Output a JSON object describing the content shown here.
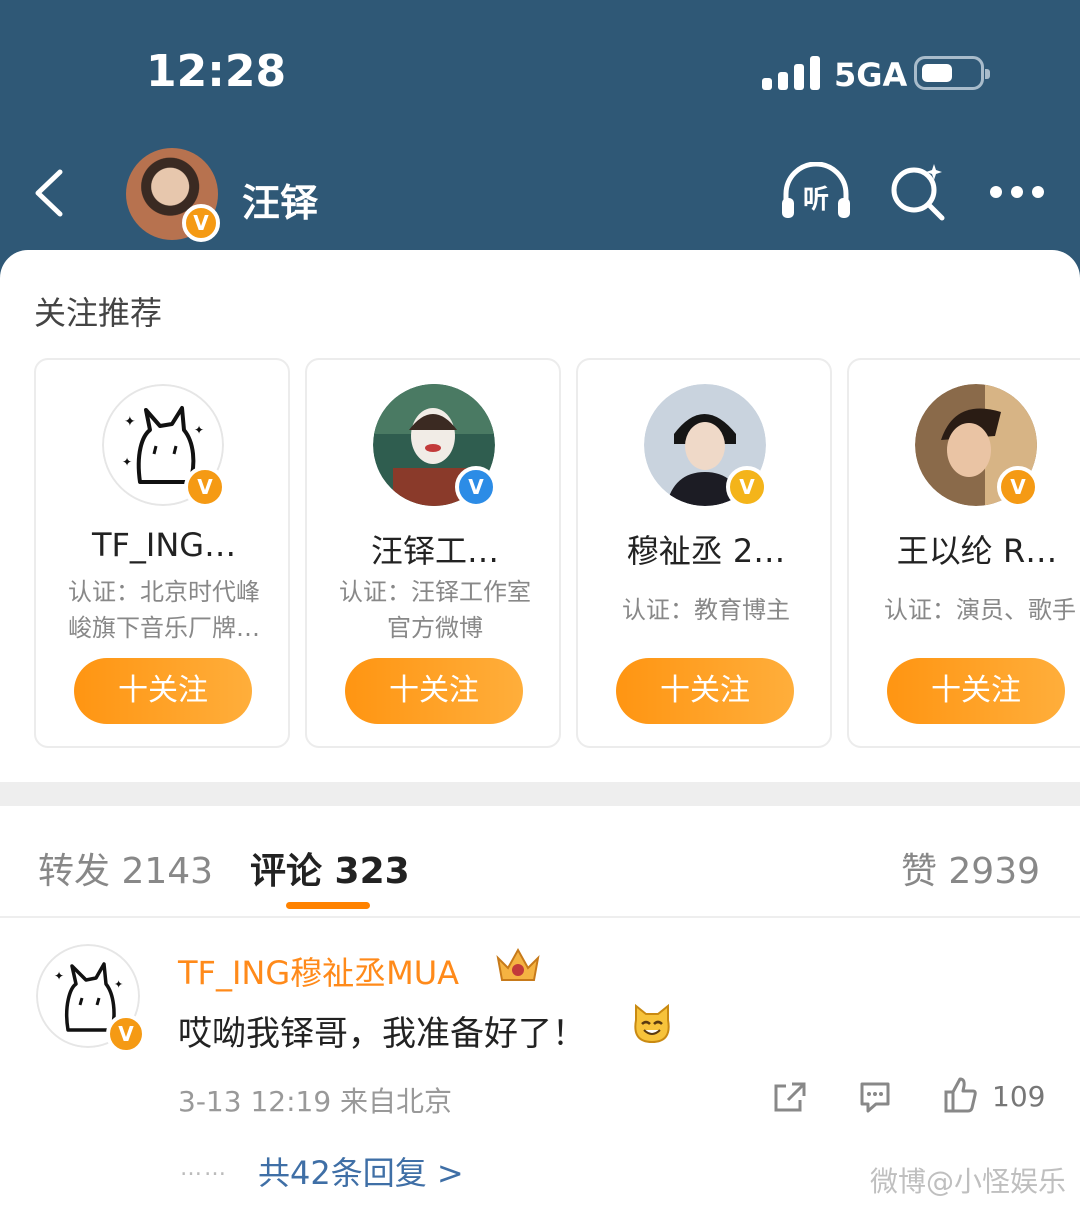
{
  "status_bar": {
    "time": "12:28",
    "network": "5GA"
  },
  "header": {
    "title": "汪铎",
    "avatar_badge": "V"
  },
  "recommend": {
    "title": "关注推荐",
    "cards": [
      {
        "name": "TF_ING…",
        "desc_line1": "认证：北京时代峰",
        "desc_line2": "峻旗下音乐厂牌…",
        "badge": "V",
        "follow": "十关注"
      },
      {
        "name": "汪铎工…",
        "desc_line1": "认证：汪铎工作室",
        "desc_line2": "官方微博",
        "badge": "V",
        "follow": "十关注"
      },
      {
        "name": "穆祉丞 2…",
        "desc_line1": "认证：教育博主",
        "badge": "V",
        "follow": "十关注"
      },
      {
        "name": "王以纶 R…",
        "desc_line1": "认证：演员、歌手",
        "badge": "V",
        "follow": "十关注"
      }
    ]
  },
  "tabs": {
    "repost": "转发 2143",
    "comment": "评论 323",
    "like": "赞 2939"
  },
  "comment": {
    "user": "TF_ING穆祉丞MUA",
    "badge": "V",
    "text": "哎呦我铎哥，我准备好了！",
    "meta": "3-13 12:19  来自北京",
    "like_count": "109",
    "dots": "……",
    "replies": "共42条回复 >"
  },
  "watermark": "微博@小怪娱乐"
}
